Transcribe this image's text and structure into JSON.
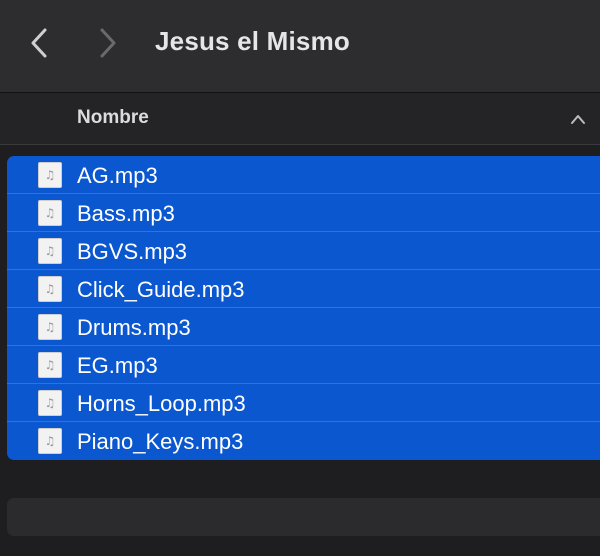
{
  "window": {
    "title": "Jesus el Mismo"
  },
  "toolbar": {
    "back_icon": "chevron-left-icon",
    "forward_icon": "chevron-right-icon"
  },
  "header": {
    "name_column": "Nombre",
    "sort_icon": "chevron-up-icon"
  },
  "files": [
    {
      "name": "AG.mp3",
      "icon": "audio-file-icon",
      "selected": true
    },
    {
      "name": "Bass.mp3",
      "icon": "audio-file-icon",
      "selected": true
    },
    {
      "name": "BGVS.mp3",
      "icon": "audio-file-icon",
      "selected": true
    },
    {
      "name": "Click_Guide.mp3",
      "icon": "audio-file-icon",
      "selected": true
    },
    {
      "name": "Drums.mp3",
      "icon": "audio-file-icon",
      "selected": true
    },
    {
      "name": "EG.mp3",
      "icon": "audio-file-icon",
      "selected": true
    },
    {
      "name": "Horns_Loop.mp3",
      "icon": "audio-file-icon",
      "selected": true
    },
    {
      "name": "Piano_Keys.mp3",
      "icon": "audio-file-icon",
      "selected": true
    }
  ],
  "colors": {
    "selection": "#0b57d0",
    "toolbar": "#2d2c2f",
    "background": "#1e1e20"
  }
}
